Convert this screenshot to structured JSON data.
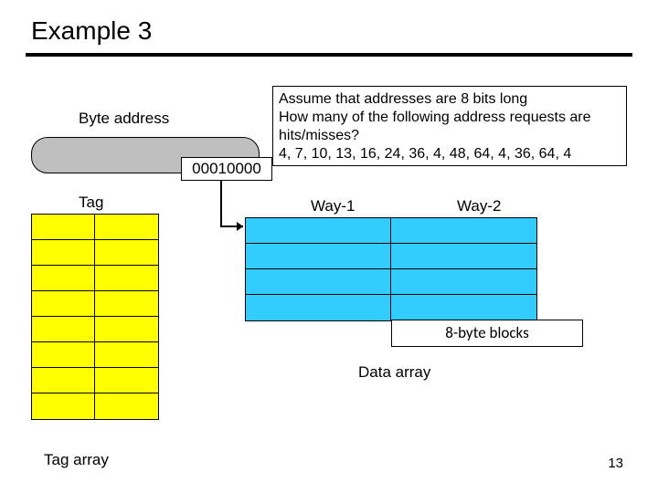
{
  "title": "Example 3",
  "byte_address_label": "Byte address",
  "binary": "00010000",
  "assume_line1": "Assume that addresses are 8 bits long",
  "assume_line2": "How many of the following address requests are hits/misses?",
  "assume_line3": "4, 7, 10, 13, 16, 24, 36, 4, 48, 64, 4, 36, 64, 4",
  "tag_label": "Tag",
  "tag_array_label": "Tag array",
  "way1_label": "Way-1",
  "way2_label": "Way-2",
  "byte_blocks": "8-byte blocks",
  "data_array_label": "Data array",
  "page_num": "13",
  "tag_rows": 8,
  "data_rows": 4
}
